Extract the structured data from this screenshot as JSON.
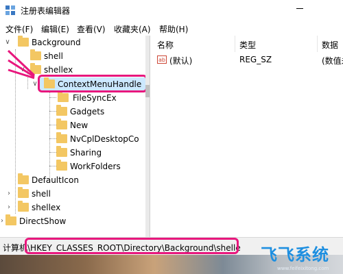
{
  "window": {
    "title": "注册表编辑器"
  },
  "menu": [
    "文件(F)",
    "编辑(E)",
    "查看(V)",
    "收藏夹(A)",
    "帮助(H)"
  ],
  "tree": {
    "items": [
      {
        "label": "Background",
        "expander": "∨"
      },
      {
        "label": "shell",
        "expander": ""
      },
      {
        "label": "shellex",
        "expander": "∨"
      },
      {
        "label": "ContextMenuHandle",
        "expander": "∨"
      },
      {
        "label": "FileSyncEx",
        "expander": ""
      },
      {
        "label": "Gadgets",
        "expander": ""
      },
      {
        "label": "New",
        "expander": ""
      },
      {
        "label": "NvCplDesktopCo",
        "expander": ""
      },
      {
        "label": "Sharing",
        "expander": ""
      },
      {
        "label": "WorkFolders",
        "expander": ""
      },
      {
        "label": "DefaultIcon",
        "expander": ""
      },
      {
        "label": "shell",
        "expander": "›"
      },
      {
        "label": "shellex",
        "expander": "›"
      },
      {
        "label": "DirectShow",
        "expander": "›"
      }
    ]
  },
  "list": {
    "columns": [
      "名称",
      "类型",
      "数据"
    ],
    "rows": [
      {
        "name": "(默认)",
        "type": "REG_SZ",
        "data": "(数值未"
      }
    ]
  },
  "status": {
    "path": "计算机\\HKEY_CLASSES_ROOT\\Directory\\Background\\shelle"
  },
  "watermark": {
    "text": "飞飞系统",
    "url": "www.feifeixitong.com"
  },
  "colors": {
    "highlight": "#e8177d",
    "selection": "#cce8ff",
    "folder": "#f3c763",
    "brand": "#1e8fe0"
  }
}
